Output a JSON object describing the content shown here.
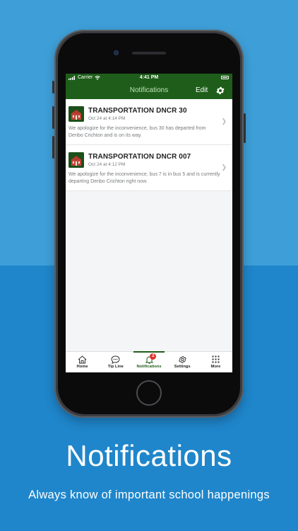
{
  "status": {
    "carrier": "Carrier",
    "time": "4:41 PM"
  },
  "nav": {
    "title": "Notifications",
    "edit_label": "Edit"
  },
  "notifications": [
    {
      "title": "TRANSPORTATION DNCR 30",
      "time": "Oct 24 at 4:14 PM",
      "body": "We apologize for the inconvenience, bus 30 has departed from Denbo Crichton and is on its way."
    },
    {
      "title": "TRANSPORTATION DNCR 007",
      "time": "Oct 24 at 4:12 PM",
      "body": "We apologize for the inconvenience, bus 7 is in bus 5 and is currently departing Denbo Crichton right now."
    }
  ],
  "tabs": [
    {
      "label": "Home",
      "icon": "home-icon"
    },
    {
      "label": "Tip Line",
      "icon": "chat-bubble-icon"
    },
    {
      "label": "Notifications",
      "icon": "bell-icon",
      "badge": "2",
      "active": true
    },
    {
      "label": "Settings",
      "icon": "gear-icon"
    },
    {
      "label": "More",
      "icon": "grid-icon"
    }
  ],
  "caption": {
    "title": "Notifications",
    "subtitle": "Always know of important school happenings"
  },
  "colors": {
    "brand_green": "#1e5e1a",
    "background_blue": "#3e9fd8",
    "badge_red": "#e0322d"
  }
}
